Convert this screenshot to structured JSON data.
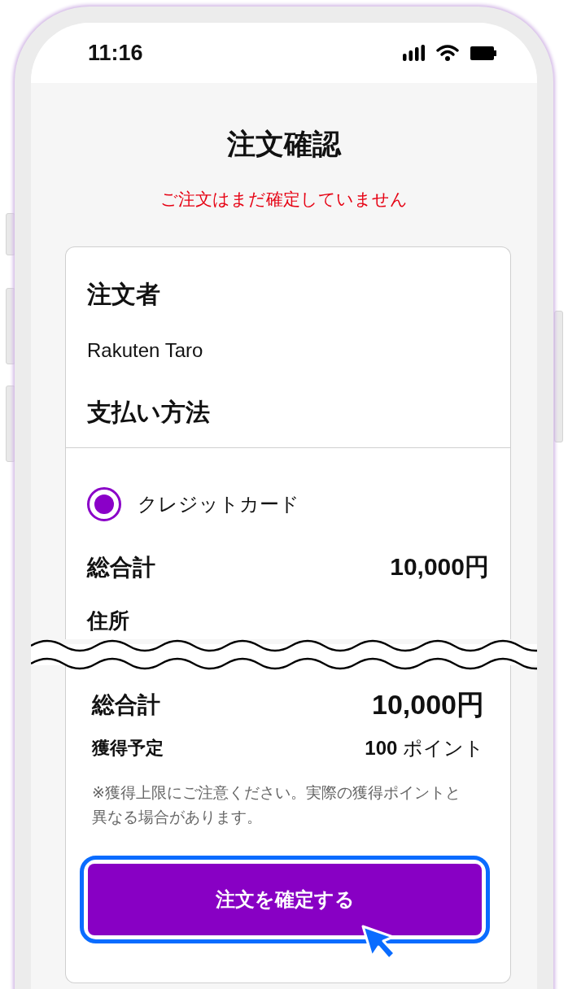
{
  "status_bar": {
    "time": "11:16"
  },
  "header": {
    "title": "注文確認",
    "notice": "ご注文はまだ確定していません"
  },
  "orderer": {
    "heading": "注文者",
    "name": "Rakuten Taro"
  },
  "payment": {
    "heading": "支払い方法",
    "options": [
      {
        "label": "クレジットカード",
        "selected": true
      }
    ]
  },
  "summary_top": {
    "total_label": "総合計",
    "total": "10,000円",
    "next_heading": "住所"
  },
  "summary": {
    "total_label": "総合計",
    "total": "10,000円",
    "points_label": "獲得予定",
    "points": "**100** ポイント",
    "note": "※獲得上限にご注意ください。実際の獲得ポイントと異なる場合があります。"
  },
  "confirm_button": {
    "label": "注文を確定する",
    "focused": true
  }
}
